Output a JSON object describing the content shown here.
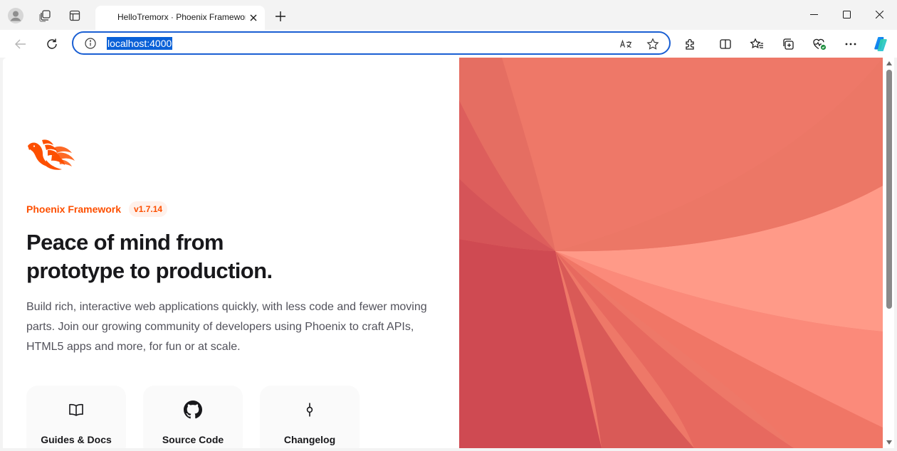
{
  "browser": {
    "tab": {
      "title": "HelloTremorx · Phoenix Framework"
    },
    "address_bar": {
      "url": "localhost:4000"
    }
  },
  "page": {
    "brand": {
      "name": "Phoenix Framework",
      "version": "v1.7.14"
    },
    "headline_line1": "Peace of mind from",
    "headline_line2": "prototype to production.",
    "lede": "Build rich, interactive web applications quickly, with less code and fewer moving parts. Join our growing community of developers using Phoenix to craft APIs, HTML5 apps and more, for fun or at scale.",
    "cards": [
      {
        "label": "Guides & Docs",
        "icon": "book-icon"
      },
      {
        "label": "Source Code",
        "icon": "github-icon"
      },
      {
        "label": "Changelog",
        "icon": "commit-icon"
      }
    ]
  },
  "colors": {
    "brand_orange": "#fd4f00",
    "address_bar_border": "#1a5fd3",
    "url_highlight": "#0a61d8"
  }
}
